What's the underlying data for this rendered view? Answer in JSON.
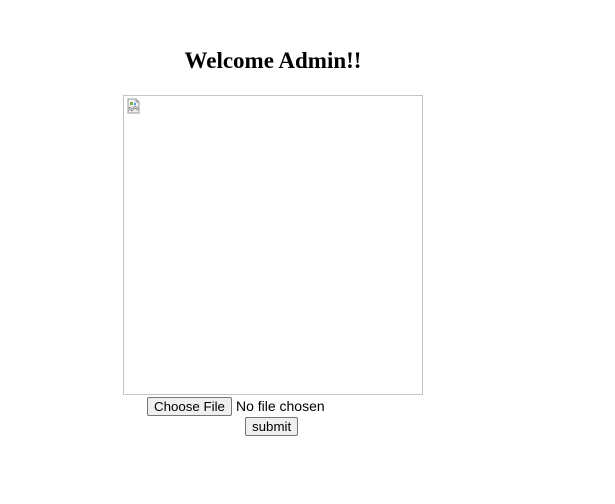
{
  "heading": "Welcome Admin!!",
  "image": {
    "icon": "broken-image-icon"
  },
  "upload": {
    "choose_label": "Choose File",
    "status": "No file chosen"
  },
  "submit_label": "submit",
  "colors": {
    "background": "#ffffff",
    "frame_border": "#c4c4c4",
    "button_bg": "#efefef",
    "button_border": "#767676"
  }
}
